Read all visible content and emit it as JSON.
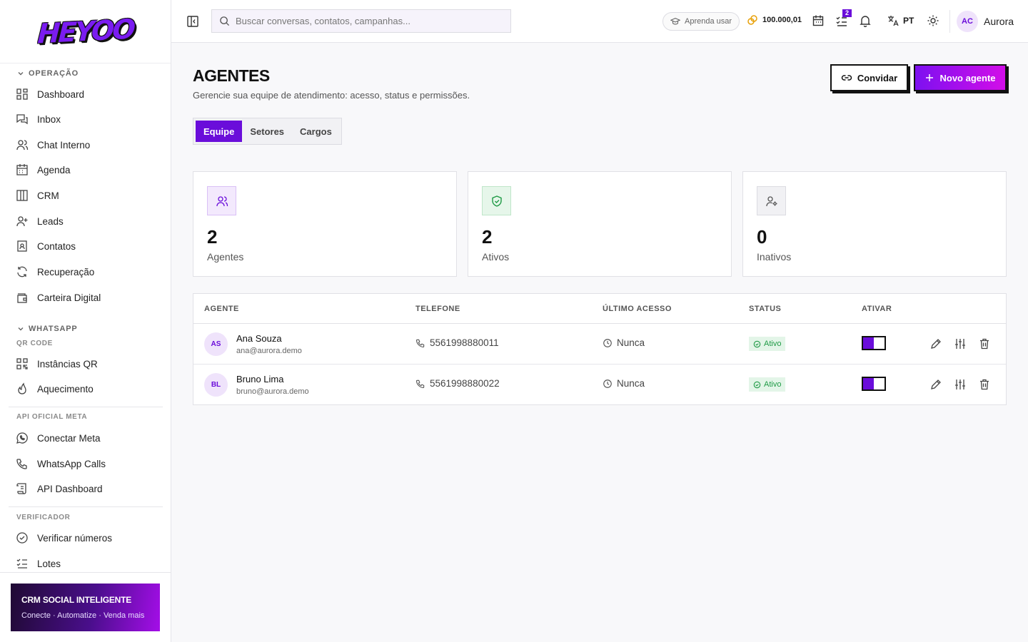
{
  "app": {
    "logo_text": "HEYOO",
    "accent": "#6a0dda"
  },
  "sidebar": {
    "groups": [
      {
        "title": "OPERAÇÃO"
      },
      {
        "title": "WHATSAPP",
        "subtitle": "QR CODE"
      },
      {
        "title": "API OFICIAL META"
      },
      {
        "title": "VERIFICADOR"
      }
    ],
    "items": [
      {
        "label": "Dashboard",
        "icon": "dashboard-icon"
      },
      {
        "label": "Inbox",
        "icon": "inbox-icon"
      },
      {
        "label": "Chat Interno",
        "icon": "users-icon"
      },
      {
        "label": "Agenda",
        "icon": "calendar-icon"
      },
      {
        "label": "CRM",
        "icon": "kanban-icon"
      },
      {
        "label": "Leads",
        "icon": "user-plus-icon"
      },
      {
        "label": "Contatos",
        "icon": "contact-book-icon"
      },
      {
        "label": "Recuperação",
        "icon": "refresh-icon"
      },
      {
        "label": "Carteira Digital",
        "icon": "wallet-icon"
      },
      {
        "label": "Instâncias QR",
        "icon": "qr-code-icon"
      },
      {
        "label": "Aquecimento",
        "icon": "flame-icon"
      },
      {
        "label": "Conectar Meta",
        "icon": "whatsapp-icon"
      },
      {
        "label": "WhatsApp Calls",
        "icon": "phone-icon"
      },
      {
        "label": "API Dashboard",
        "icon": "scroll-icon"
      },
      {
        "label": "Verificar números",
        "icon": "check-circle-icon"
      },
      {
        "label": "Lotes",
        "icon": "list-checks-icon"
      }
    ],
    "promo": {
      "title": "CRM SOCIAL INTELIGENTE",
      "subtitle": "Conecte · Automatize · Venda mais"
    }
  },
  "topbar": {
    "search_placeholder": "Buscar conversas, contatos, campanhas...",
    "learn_label": "Aprenda usar",
    "credits": "100.000,01",
    "tasks_badge": "2",
    "language": "PT",
    "user_initials": "AC",
    "user_name": "Aurora"
  },
  "page": {
    "title": "AGENTES",
    "subtitle": "Gerencie sua equipe de atendimento: acesso, status e permissões.",
    "invite_label": "Convidar",
    "new_agent_label": "Novo agente",
    "tabs": [
      {
        "label": "Equipe",
        "active": true
      },
      {
        "label": "Setores",
        "active": false
      },
      {
        "label": "Cargos",
        "active": false
      }
    ]
  },
  "stats": [
    {
      "value": "2",
      "label": "Agentes",
      "icon": "users-icon",
      "color": "#6a0dda"
    },
    {
      "value": "2",
      "label": "Ativos",
      "icon": "shield-check-icon",
      "color": "#1e9a45"
    },
    {
      "value": "0",
      "label": "Inativos",
      "icon": "user-cog-icon",
      "color": "#555555"
    }
  ],
  "table": {
    "headers": [
      "AGENTE",
      "TELEFONE",
      "ÚLTIMO ACESSO",
      "STATUS",
      "ATIVAR"
    ],
    "rows": [
      {
        "initials": "AS",
        "name": "Ana Souza",
        "email": "ana@aurora.demo",
        "phone": "5561998880011",
        "last_access": "Nunca",
        "status": "Ativo",
        "enabled": true
      },
      {
        "initials": "BL",
        "name": "Bruno Lima",
        "email": "bruno@aurora.demo",
        "phone": "5561998880022",
        "last_access": "Nunca",
        "status": "Ativo",
        "enabled": true
      }
    ]
  }
}
